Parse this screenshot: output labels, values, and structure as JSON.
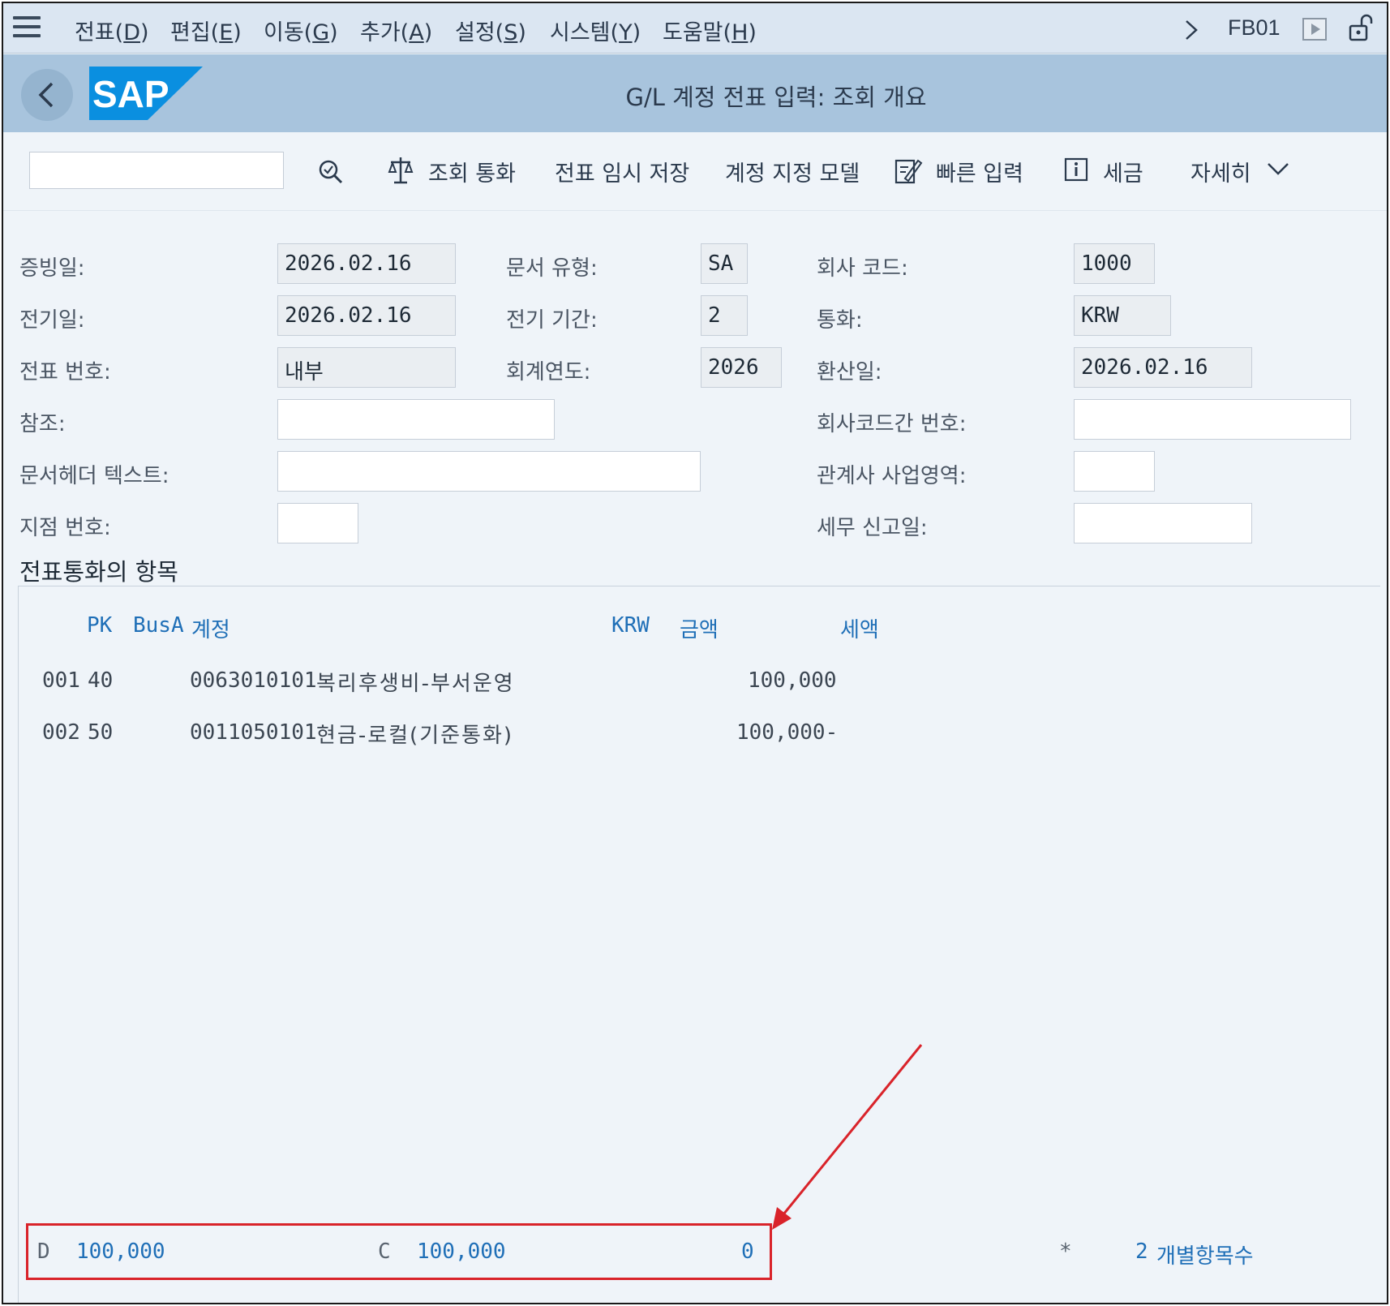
{
  "menu": {
    "items": [
      {
        "pre": "전표(",
        "key": "D",
        "post": ")"
      },
      {
        "pre": "편집(",
        "key": "E",
        "post": ")"
      },
      {
        "pre": "이동(",
        "key": "G",
        "post": ")"
      },
      {
        "pre": "추가(",
        "key": "A",
        "post": ")"
      },
      {
        "pre": "설정(",
        "key": "S",
        "post": ")"
      },
      {
        "pre": "시스템(",
        "key": "Y",
        "post": ")"
      },
      {
        "pre": "도움말(",
        "key": "H",
        "post": ")"
      }
    ],
    "tcode": "FB01"
  },
  "title": {
    "text": "G/L 계정 전표 입력: 조회 개요",
    "logo_text": "SAP"
  },
  "toolbar": {
    "display_currency": "조회 통화",
    "park_document": "전표 임시 저장",
    "acct_model": "계정 지정 모델",
    "fast_entry": "빠른 입력",
    "taxes": "세금",
    "more": "자세히"
  },
  "header": {
    "doc_date_label": "증빙일:",
    "doc_date": "2026.02.16",
    "doc_type_label": "문서 유형:",
    "doc_type": "SA",
    "company_code_label": "회사 코드:",
    "company_code": "1000",
    "posting_date_label": "전기일:",
    "posting_date": "2026.02.16",
    "period_label": "전기 기간:",
    "period": "2",
    "currency_label": "통화:",
    "currency": "KRW",
    "doc_number_label": "전표 번호:",
    "doc_number": "내부",
    "fiscal_year_label": "회계연도:",
    "fiscal_year": "2026",
    "translation_date_label": "환산일:",
    "translation_date": "2026.02.16",
    "reference_label": "참조:",
    "reference": "",
    "cross_cc_label": "회사코드간 번호:",
    "cross_cc": "",
    "header_text_label": "문서헤더 텍스트:",
    "header_text": "",
    "trading_partner_label": "관계사 사업영역:",
    "trading_partner": "",
    "branch_label": "지점 번호:",
    "branch": "",
    "tax_report_date_label": "세무 신고일:",
    "tax_report_date": ""
  },
  "items": {
    "section_title": "전표통화의 항목",
    "columns": {
      "pk": "PK",
      "busa": "BusA",
      "account": "계정",
      "currency": "KRW",
      "amount": "금액",
      "tax": "세액"
    },
    "rows": [
      {
        "no": "001",
        "pk": "40",
        "account": "0063010101",
        "desc": "복리후생비-부서운영",
        "amount": "100,000"
      },
      {
        "no": "002",
        "pk": "50",
        "account": "0011050101",
        "desc": "현금-로컬(기준통화)",
        "amount": "100,000-"
      }
    ]
  },
  "totals": {
    "debit_label": "D",
    "debit": "100,000",
    "credit_label": "C",
    "credit": "100,000",
    "balance": "0",
    "star": "*",
    "item_count": "2",
    "item_count_label": "개별항목수"
  },
  "colors": {
    "accent": "#1f6fb7",
    "highlight": "#d9232a",
    "titlebar": "#a8c4dd"
  }
}
